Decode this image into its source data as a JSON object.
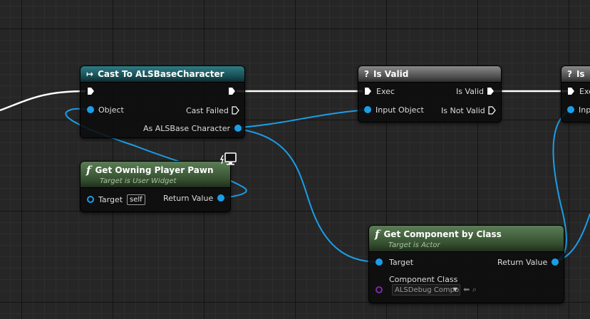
{
  "graph": {
    "nodes": {
      "cast": {
        "title": "Cast To ALSBaseCharacter",
        "pins": {
          "object": "Object",
          "cast_failed": "Cast Failed",
          "as_character": "As ALSBase Character"
        }
      },
      "is_valid": {
        "title": "Is Valid",
        "pins": {
          "exec": "Exec",
          "input_object": "Input Object",
          "is_valid": "Is Valid",
          "is_not_valid": "Is Not Valid"
        }
      },
      "is_valid_2": {
        "title": "Is",
        "pins": {
          "exec": "Exe",
          "input": "Inp"
        }
      },
      "get_owning_pawn": {
        "title": "Get Owning Player Pawn",
        "subtitle": "Target is User Widget",
        "pins": {
          "target": "Target",
          "target_default": "self",
          "return_value": "Return Value"
        }
      },
      "get_component": {
        "title": "Get Component by Class",
        "subtitle": "Target is Actor",
        "pins": {
          "target": "Target",
          "return_value": "Return Value",
          "component_class": "Component Class",
          "component_class_value": "ALSDebug Compo"
        }
      }
    },
    "colors": {
      "exec_wire": "#ffffff",
      "object_wire": "#1a9ee8",
      "class_pin": "#7a2aa8",
      "cast_header": "#154a50",
      "macro_header": "#4d4d4d",
      "function_header": "#35502f"
    },
    "icons": {
      "cast_header": "cast-arrows-icon",
      "macro_header": "question-mark-icon",
      "function_header": "function-f-icon",
      "context": "monitor-context-icon"
    }
  }
}
